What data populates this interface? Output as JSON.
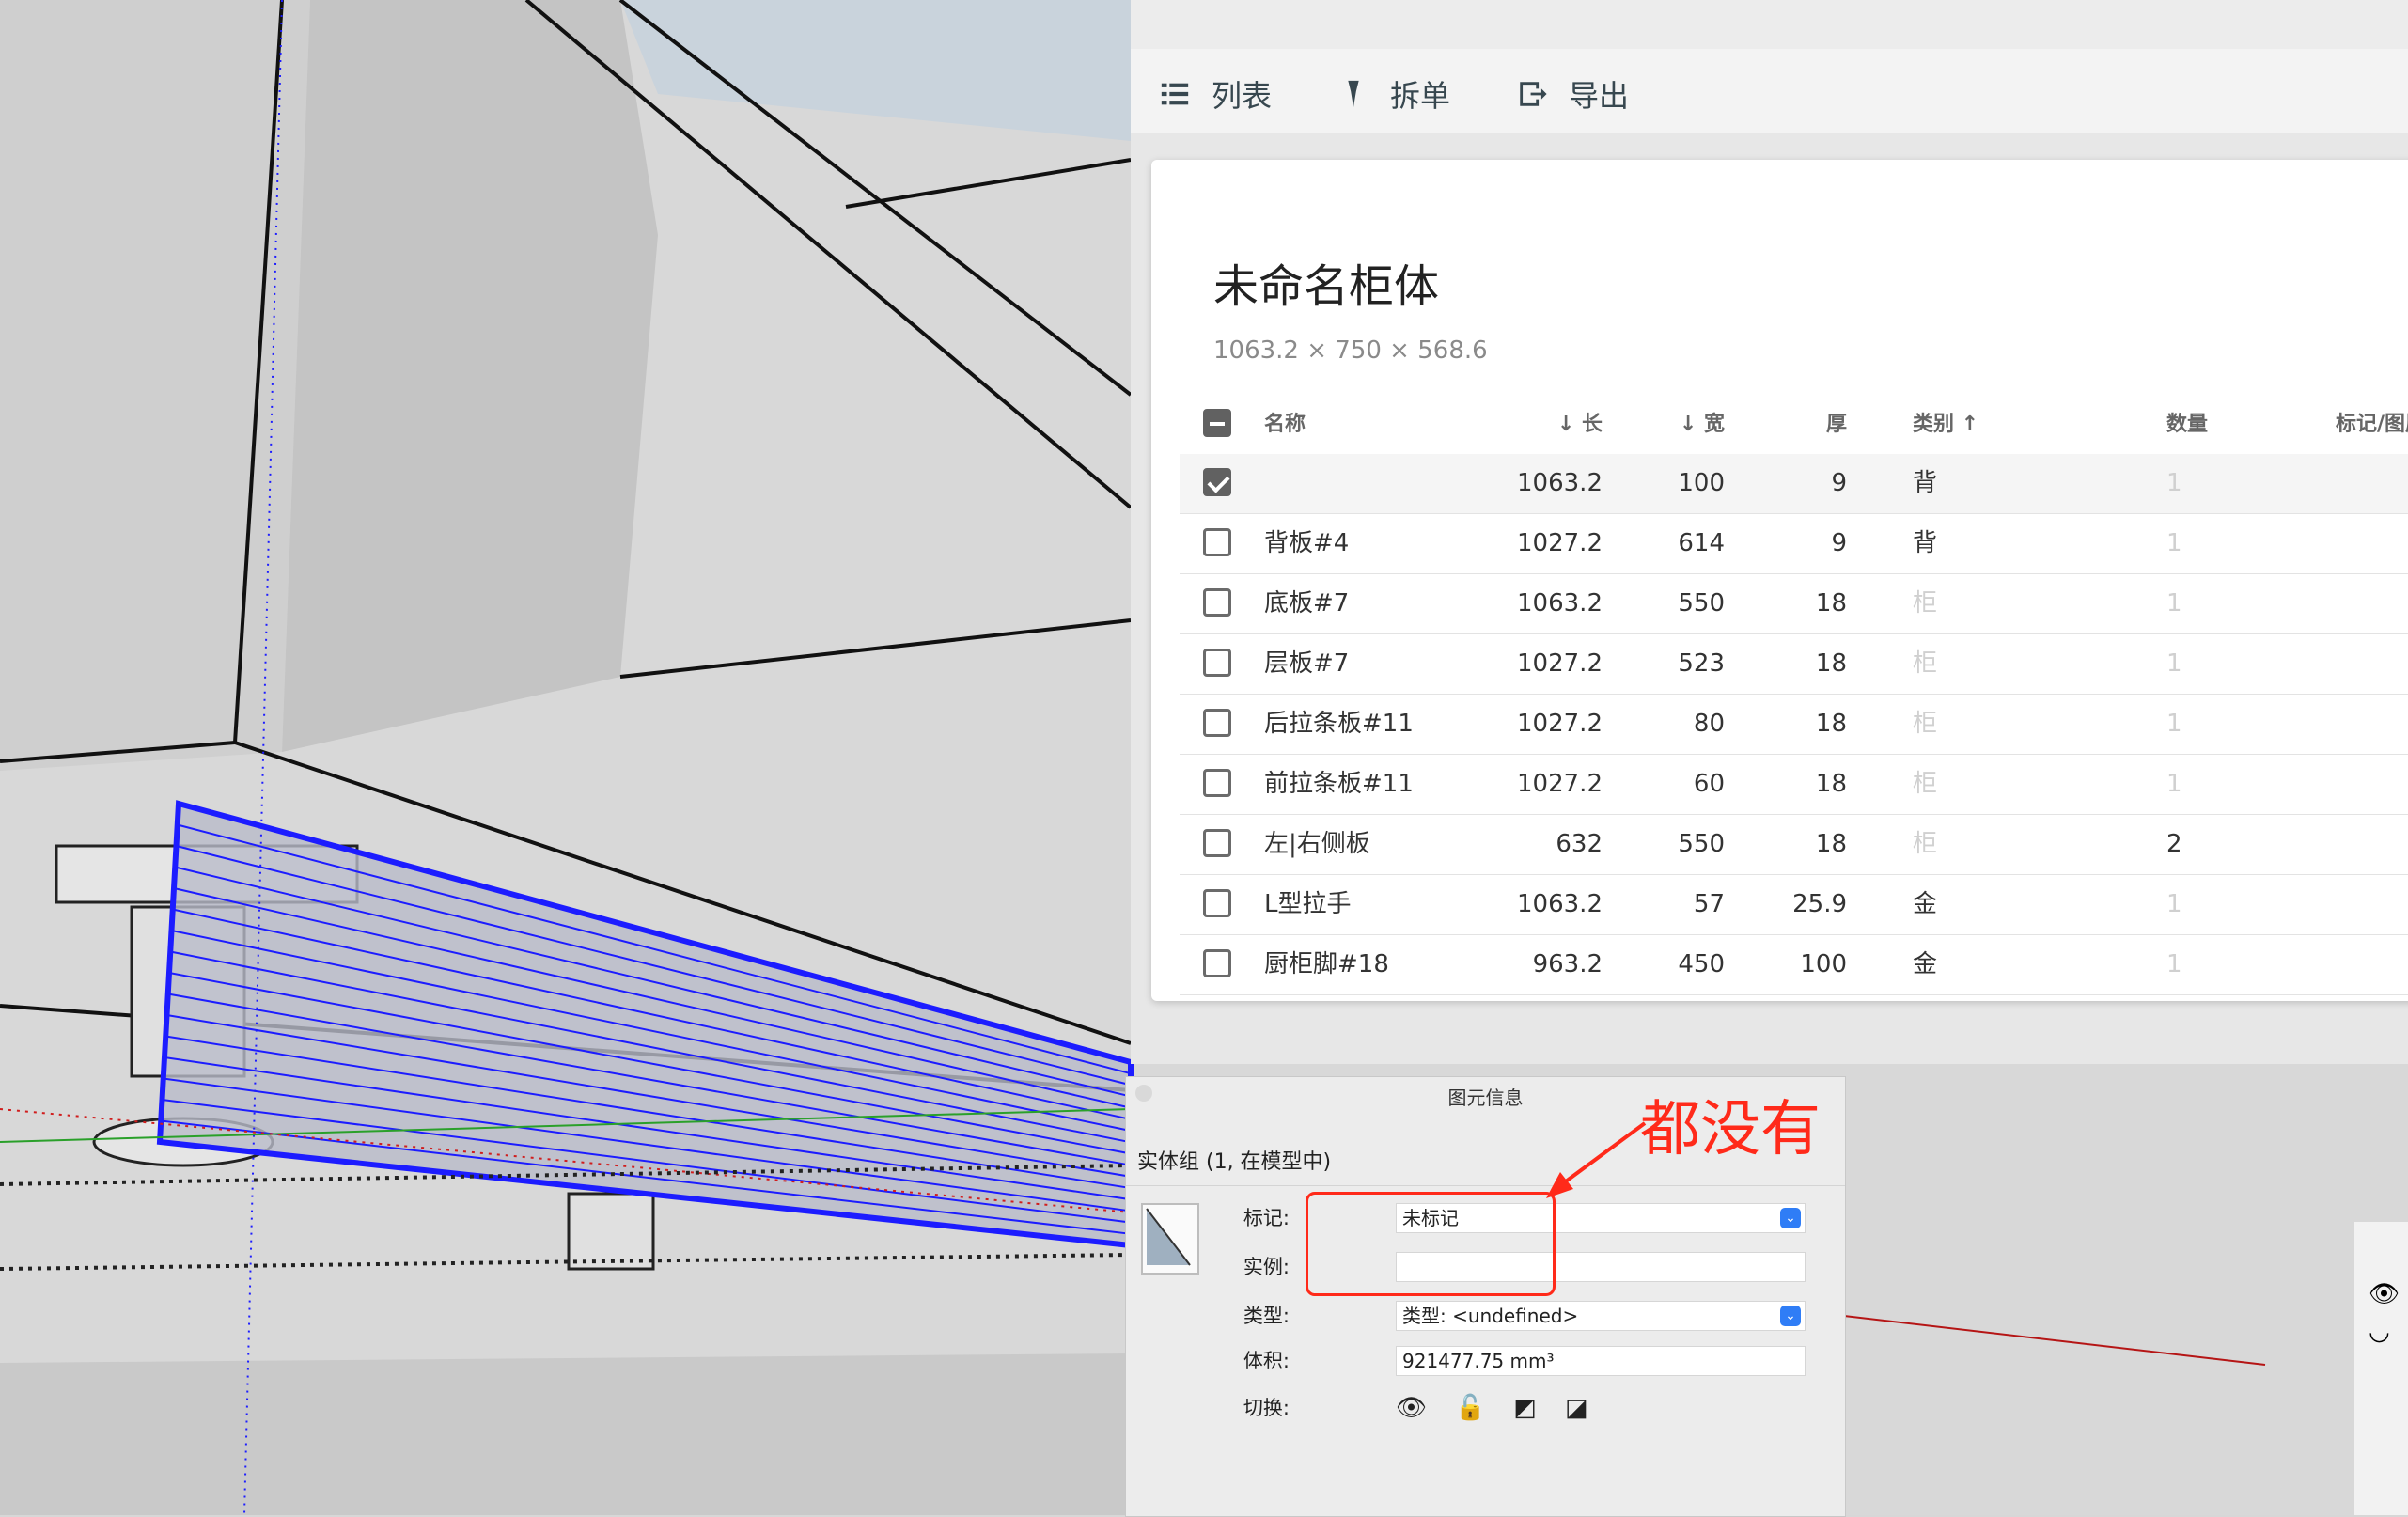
{
  "toolbar": {
    "list_label": "列表",
    "split_label": "拆单",
    "export_label": "导出"
  },
  "card": {
    "title": "未命名柜体",
    "dimensions": "1063.2 × 750 × 568.6",
    "columns": {
      "name": "名称",
      "length": "长",
      "width": "宽",
      "thickness": "厚",
      "category": "类别",
      "quantity": "数量",
      "tag": "标记/图层"
    },
    "rows": [
      {
        "name": "",
        "length": "1063.2",
        "width": "100",
        "thickness": "9",
        "category": "背",
        "quantity": "1",
        "checked": true
      },
      {
        "name": "背板#4",
        "length": "1027.2",
        "width": "614",
        "thickness": "9",
        "category": "背",
        "quantity": "1",
        "checked": false
      },
      {
        "name": "底板#7",
        "length": "1063.2",
        "width": "550",
        "thickness": "18",
        "category": "柜",
        "quantity": "1",
        "checked": false
      },
      {
        "name": "层板#7",
        "length": "1027.2",
        "width": "523",
        "thickness": "18",
        "category": "柜",
        "quantity": "1",
        "checked": false
      },
      {
        "name": "后拉条板#11",
        "length": "1027.2",
        "width": "80",
        "thickness": "18",
        "category": "柜",
        "quantity": "1",
        "checked": false
      },
      {
        "name": "前拉条板#11",
        "length": "1027.2",
        "width": "60",
        "thickness": "18",
        "category": "柜",
        "quantity": "1",
        "checked": false
      },
      {
        "name": "左|右侧板",
        "length": "632",
        "width": "550",
        "thickness": "18",
        "category": "柜",
        "quantity": "2",
        "checked": false
      },
      {
        "name": "L型拉手",
        "length": "1063.2",
        "width": "57",
        "thickness": "25.9",
        "category": "金",
        "quantity": "1",
        "checked": false
      },
      {
        "name": "厨柜脚#18",
        "length": "963.2",
        "width": "450",
        "thickness": "100",
        "category": "金",
        "quantity": "1",
        "checked": false
      }
    ]
  },
  "entity_info": {
    "title": "图元信息",
    "subtitle": "实体组 (1, 在模型中)",
    "tag_label": "标记:",
    "tag_value": "未标记",
    "instance_label": "实例:",
    "instance_value": "",
    "type_label": "类型:",
    "type_value": "类型: <undefined>",
    "volume_label": "体积:",
    "volume_value": "921477.75 mm³",
    "toggle_label": "切换:"
  },
  "annotation": {
    "text": "都没有"
  },
  "colors": {
    "accent_red": "#ff2a1a",
    "selection_blue": "#1c1cff",
    "toolbar_text": "#37474f"
  }
}
